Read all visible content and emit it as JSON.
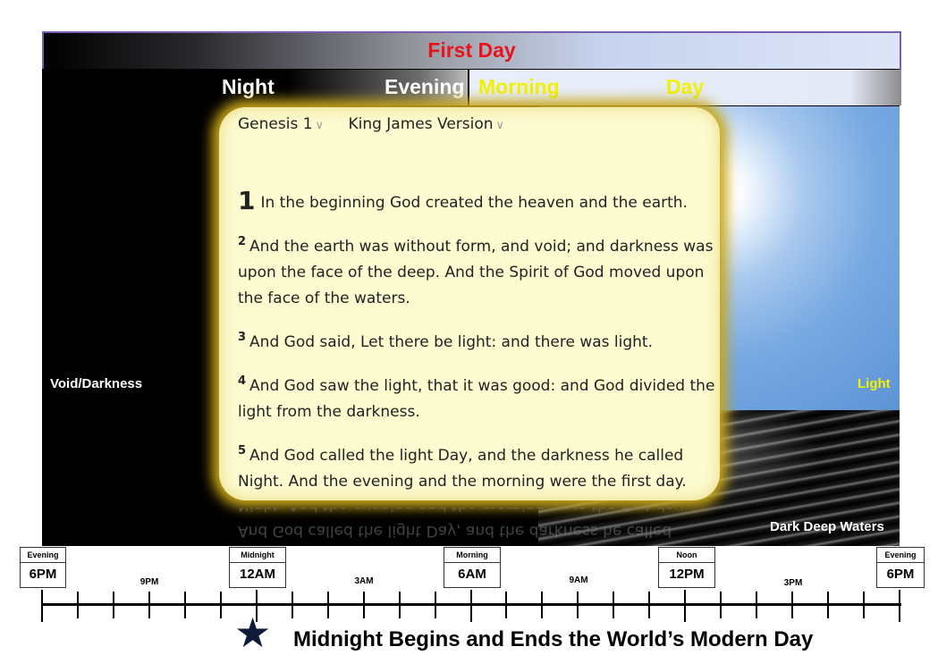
{
  "banner": {
    "title": "First Day"
  },
  "periods": {
    "night": "Night",
    "evening": "Evening",
    "morning": "Morning",
    "day": "Day"
  },
  "panel": {
    "left_label": "Void/Darkness",
    "right_label": "Light",
    "water_label": "Dark Deep Waters"
  },
  "reader": {
    "book": "Genesis 1",
    "version": "King James Version",
    "verses": [
      {
        "num": "1",
        "text": "In the beginning God created the heaven and the earth."
      },
      {
        "num": "2",
        "text": "And the earth was without form, and void; and darkness was upon the face of the deep. And the Spirit of God moved upon the face of the waters."
      },
      {
        "num": "3",
        "text": "And God said, Let there be light: and there was light."
      },
      {
        "num": "4",
        "text": "And God saw the light, that it was good: and God divided the light from the darkness."
      },
      {
        "num": "5",
        "text": "And God called the light Day, and the darkness he called Night. And the evening and the morning were the first day."
      }
    ]
  },
  "timeline": {
    "boxes": [
      {
        "top": "Evening",
        "time": "6PM"
      },
      {
        "top": "Midnight",
        "time": "12AM"
      },
      {
        "top": "Morning",
        "time": "6AM"
      },
      {
        "top": "Noon",
        "time": "12PM"
      },
      {
        "top": "Evening",
        "time": "6PM"
      }
    ],
    "hours": [
      "9PM",
      "3AM",
      "9AM",
      "3PM"
    ]
  },
  "caption": "Midnight Begins and Ends the World’s Modern Day",
  "colors": {
    "title_red": "#e8141b",
    "period_yellow": "#f2f200",
    "card_bg": "#fdfbd0",
    "card_glow": "#c9a718"
  }
}
